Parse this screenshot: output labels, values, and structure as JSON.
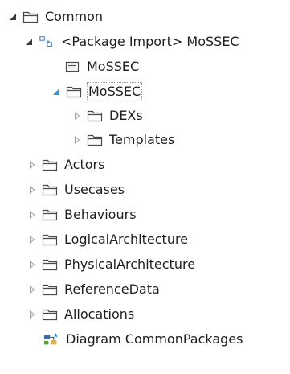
{
  "colors": {
    "text": "#1e1e1e",
    "folder_stroke": "#4a4a4a",
    "expanded_arrow": "#3a3a3a",
    "selected_arrow": "#3d8fd1",
    "collapsed_arrow": "#a5a5a5",
    "package_import_icon": "#4a86c5",
    "diagram_icon_blue": "#3a6fb0",
    "diagram_icon_yellow": "#e3b23c",
    "diagram_icon_green": "#5a9e3a"
  },
  "tree": {
    "root": {
      "label": "Common",
      "icon": "folder-icon",
      "state": "expanded"
    },
    "package_import": {
      "label": "<Package Import> MoSSEC",
      "icon": "package-import-icon",
      "state": "expanded"
    },
    "mossec_element": {
      "label": "MoSSEC",
      "icon": "model-element-icon"
    },
    "mossec_folder": {
      "label": "MoSSEC",
      "icon": "folder-icon",
      "state": "expanded",
      "selected": true
    },
    "dexs": {
      "label": "DEXs",
      "icon": "folder-icon",
      "state": "collapsed"
    },
    "templates": {
      "label": "Templates",
      "icon": "folder-icon",
      "state": "collapsed"
    },
    "actors": {
      "label": "Actors",
      "icon": "folder-icon",
      "state": "collapsed"
    },
    "usecases": {
      "label": "Usecases",
      "icon": "folder-icon",
      "state": "collapsed"
    },
    "behaviours": {
      "label": "Behaviours",
      "icon": "folder-icon",
      "state": "collapsed"
    },
    "logical_architecture": {
      "label": "LogicalArchitecture",
      "icon": "folder-icon",
      "state": "collapsed"
    },
    "physical_architecture": {
      "label": "PhysicalArchitecture",
      "icon": "folder-icon",
      "state": "collapsed"
    },
    "reference_data": {
      "label": "ReferenceData",
      "icon": "folder-icon",
      "state": "collapsed"
    },
    "allocations": {
      "label": "Allocations",
      "icon": "folder-icon",
      "state": "collapsed"
    },
    "diagram": {
      "label": "Diagram CommonPackages",
      "icon": "diagram-icon"
    }
  }
}
